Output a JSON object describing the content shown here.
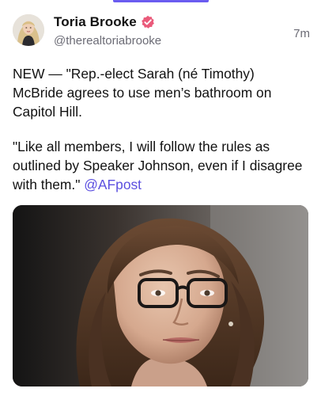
{
  "post": {
    "author": {
      "display_name": "Toria Brooke",
      "handle": "@therealtoriabrooke",
      "avatar_icon": "avatar-photo",
      "verified_icon": "verified-badge-icon",
      "verified_color": "#ea5a7a"
    },
    "timestamp": "7m",
    "paragraph_1": "NEW — \"Rep.-elect Sarah (né Timothy) McBride agrees to use men’s bathroom on Capitol Hill.",
    "paragraph_2_text": "\"Like all members, I will follow the rules as outlined by Speaker Johnson, even if I disagree with them.\" ",
    "paragraph_2_mention": "@AFpost",
    "media": {
      "type": "photo"
    }
  },
  "colors": {
    "accent": "#6a5cf0",
    "mention": "#5b4fe0",
    "secondary_text": "#6b6b75"
  }
}
